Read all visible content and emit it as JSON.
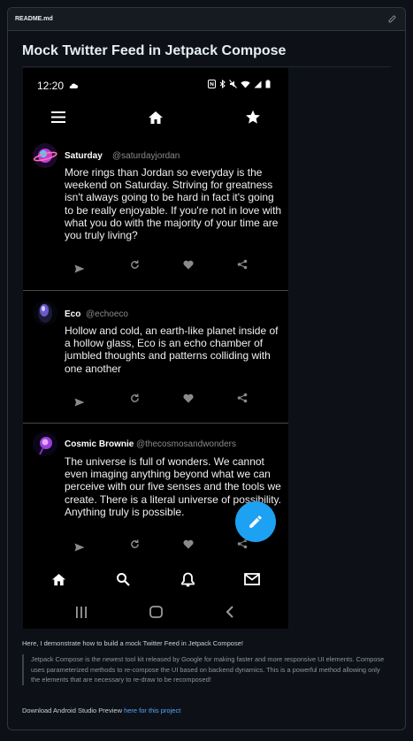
{
  "readme": {
    "file_name": "README.md",
    "title": "Mock Twitter Feed in Jetpack Compose",
    "intro": "Here, I demonstrate how to build a mock Twitter Feed in Jetpack Compose!",
    "quote": "Jetpack Compose is the newest tool kit released by Google for making faster and more responsive UI elements. Compose uses parameterized methods to re-compose the UI based on backend dynamics. This is a powerful method allowing only the elements that are necessary to re-draw to be recomposed!",
    "download_text": "Download Android Studio Preview",
    "download_link": "here for this project"
  },
  "phone": {
    "status_time": "12:20",
    "tweets": [
      {
        "name": "Saturday",
        "handle": "@saturdayjordan",
        "text": "More rings than Jordan so everyday is the weekend on Saturday. Striving for greatness isn't always going to be hard in fact it's going to be really enjoyable. If you're not in love with what you do with the majority of your time are you truly living?"
      },
      {
        "name": "Eco",
        "handle": "@echoeco",
        "text": "Hollow and cold, an earth-like planet inside of a hollow glass, Eco is an echo chamber of jumbled thoughts and patterns colliding with one another"
      },
      {
        "name": "Cosmic Brownie",
        "handle": "@thecosmosandwonders",
        "text": "The universe is full of wonders. We cannot even imaging anything beyond what we can perceive with our five senses and the tools we create. There is a literal universe of possibility. Anything truly is possible."
      }
    ]
  },
  "colors": {
    "fab": "#1da1f2",
    "link": "#58a6ff",
    "background": "#0d1117"
  },
  "icons": [
    "pencil-icon",
    "hamburger-menu-icon",
    "home-icon",
    "star-icon",
    "send-icon",
    "retweet-icon",
    "heart-icon",
    "share-icon",
    "search-icon",
    "bell-icon",
    "mail-icon",
    "edit-icon"
  ]
}
